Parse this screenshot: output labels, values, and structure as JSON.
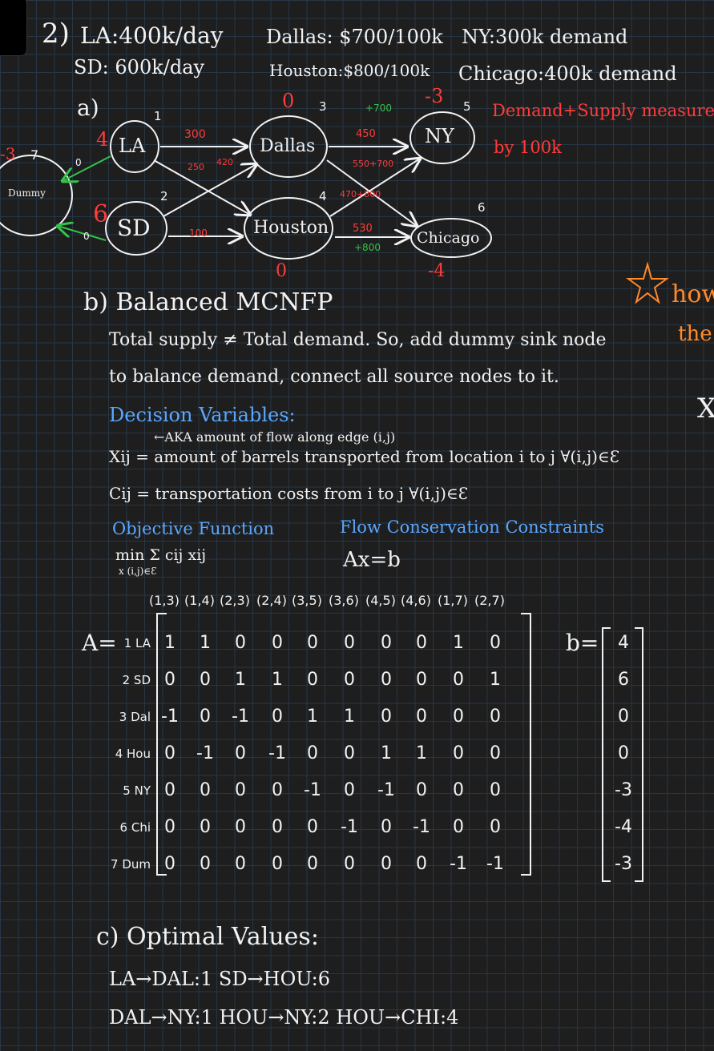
{
  "problem": {
    "number": "2)",
    "la_supply": "LA:400k/day",
    "sd_supply": "SD: 600k/day",
    "dallas_cost": "Dallas: $700/100k",
    "houston_cost": "Houston:$800/100k",
    "ny_demand": "NY:300k demand",
    "chicago_demand": "Chicago:400k demand"
  },
  "part_a": {
    "label": "a)",
    "note_line1": "Demand+Supply measured",
    "note_line2": "by 100k",
    "nodes": {
      "la": "LA",
      "sd": "SD",
      "dallas": "Dallas",
      "houston": "Houston",
      "ny": "NY",
      "chicago": "Chicago",
      "dummy": "Dummy"
    },
    "node_numbers": {
      "la": "1",
      "sd": "2",
      "dallas": "3",
      "houston": "4",
      "ny": "5",
      "chicago": "6",
      "dummy": "7"
    },
    "supplies": {
      "la": "4",
      "sd": "6",
      "dallas": "0",
      "houston": "0",
      "ny": "-3",
      "chicago": "-4",
      "dummy": "-3"
    },
    "edge_labels": {
      "la_dal": "300",
      "la_hou": "420",
      "sd_dal": "250",
      "sd_hou": "100",
      "dal_ny": "450",
      "dal_ny_add": "+700",
      "dal_chi": "550+700",
      "hou_ny": "470+800",
      "hou_chi": "530",
      "hou_chi_add": "+800",
      "la_dum": "0",
      "sd_dum": "0"
    }
  },
  "part_b": {
    "heading": "b) Balanced MCNFP",
    "text1": "Total supply ≠ Total demand. So, add dummy sink node",
    "text2": "to balance demand, connect all source nodes to it.",
    "dv_heading": "Decision Variables:",
    "aka": "←AKA amount of flow along edge (i,j)",
    "xij": "Xij = amount of barrels transported from location i to j ∀(i,j)∈Ɛ",
    "cij": "Cij = transportation costs from i to j ∀(i,j)∈Ɛ",
    "obj_heading": "Objective Function",
    "obj": "min Σ cij xij",
    "obj_sub": "x  (i,j)∈Ɛ",
    "flow_heading": "Flow Conservation Constraints",
    "flow_eq": "Ax=b",
    "matrix": {
      "a_label": "A=",
      "b_label": "b=",
      "columns": [
        "(1,3)",
        "(1,4)",
        "(2,3)",
        "(2,4)",
        "(3,5)",
        "(3,6)",
        "(4,5)",
        "(4,6)",
        "(1,7)",
        "(2,7)"
      ],
      "row_labels": [
        "1 LA",
        "2 SD",
        "3 Dal",
        "4 Hou",
        "5 NY",
        "6 Chi",
        "7 Dum"
      ],
      "rows": [
        [
          "1",
          "1",
          "0",
          "0",
          "0",
          "0",
          "0",
          "0",
          "1",
          "0"
        ],
        [
          "0",
          "0",
          "1",
          "1",
          "0",
          "0",
          "0",
          "0",
          "0",
          "1"
        ],
        [
          "-1",
          "0",
          "-1",
          "0",
          "1",
          "1",
          "0",
          "0",
          "0",
          "0"
        ],
        [
          "0",
          "-1",
          "0",
          "-1",
          "0",
          "0",
          "1",
          "1",
          "0",
          "0"
        ],
        [
          "0",
          "0",
          "0",
          "0",
          "-1",
          "0",
          "-1",
          "0",
          "0",
          "0"
        ],
        [
          "0",
          "0",
          "0",
          "0",
          "0",
          "-1",
          "0",
          "-1",
          "0",
          "0"
        ],
        [
          "0",
          "0",
          "0",
          "0",
          "0",
          "0",
          "0",
          "0",
          "-1",
          "-1"
        ]
      ],
      "b": [
        "4",
        "6",
        "0",
        "0",
        "-3",
        "-4",
        "-3"
      ]
    },
    "side_note1": "how",
    "side_note2": "the",
    "side_x": "X"
  },
  "part_c": {
    "heading": "c) Optimal Values:",
    "line1": "LA→DAL:1  SD→HOU:6",
    "line2": "DAL→NY:1  HOU→NY:2  HOU→CHI:4"
  }
}
